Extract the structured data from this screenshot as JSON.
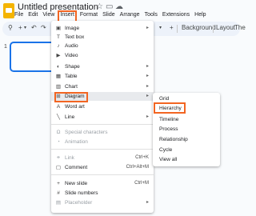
{
  "title": "Untitled presentation",
  "menubar": [
    "File",
    "Edit",
    "View",
    "Insert",
    "Format",
    "Slide",
    "Arrange",
    "Tools",
    "Extensions",
    "Help"
  ],
  "toolbar": {
    "background": "Background",
    "layout": "Layout",
    "theme_truncated": "The",
    "zoom_icon": "+"
  },
  "slide_number": "1",
  "insert_menu": {
    "items": [
      {
        "label": "Image",
        "icon": "image-icon"
      },
      {
        "label": "Text box",
        "icon": "text-box-icon"
      },
      {
        "label": "Audio",
        "icon": "audio-icon"
      },
      {
        "label": "Video",
        "icon": "video-icon"
      },
      {
        "label": "Shape",
        "icon": "shape-icon"
      },
      {
        "label": "Table",
        "icon": "table-icon"
      },
      {
        "label": "Chart",
        "icon": "chart-icon"
      },
      {
        "label": "Diagram",
        "icon": "diagram-icon"
      },
      {
        "label": "Word art",
        "icon": "word-art-icon"
      },
      {
        "label": "Line",
        "icon": "line-icon"
      },
      {
        "label": "Special characters",
        "icon": "special-characters-icon"
      },
      {
        "label": "Animation",
        "icon": "animation-icon"
      },
      {
        "label": "Link",
        "icon": "link-icon",
        "shortcut": "Ctrl+K"
      },
      {
        "label": "Comment",
        "icon": "comment-icon",
        "shortcut": "Ctrl+Alt+M"
      },
      {
        "label": "New slide",
        "icon": "new-slide-icon",
        "shortcut": "Ctrl+M"
      },
      {
        "label": "Slide numbers",
        "icon": "slide-numbers-icon"
      },
      {
        "label": "Placeholder",
        "icon": "placeholder-icon"
      }
    ]
  },
  "diagram_submenu": [
    "Grid",
    "Hierarchy",
    "Timeline",
    "Process",
    "Relationship",
    "Cycle",
    "View all"
  ],
  "colors": {
    "accent": "#1a73e8",
    "highlight": "#f26522"
  }
}
